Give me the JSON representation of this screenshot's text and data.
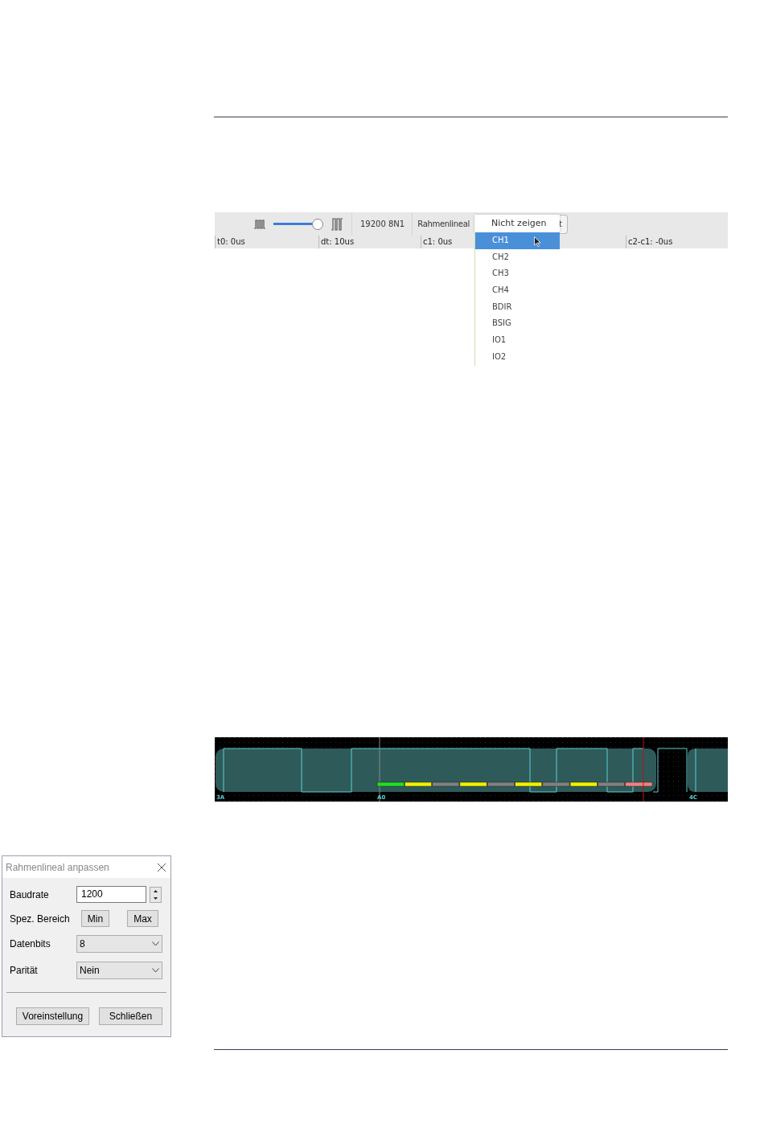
{
  "toolbar": {
    "rate_slider": {
      "level": 0.92
    },
    "serial_format": "19200 8N1",
    "ruler_label": "Rahmenlineal",
    "covered_button_text": "t"
  },
  "ruler_dropdown": {
    "value": "Nicht zeigen",
    "options": [
      {
        "label": "CH1",
        "selected": true
      },
      {
        "label": "CH2",
        "selected": false
      },
      {
        "label": "CH3",
        "selected": false
      },
      {
        "label": "CH4",
        "selected": false
      },
      {
        "label": "BDIR",
        "selected": false
      },
      {
        "label": "BSIG",
        "selected": false
      },
      {
        "label": "IO1",
        "selected": false
      },
      {
        "label": "IO2",
        "selected": false
      }
    ]
  },
  "status_cells": [
    "t0: 0us",
    "dt: 10us",
    "c1: 0us",
    "c2-c1: -0us"
  ],
  "waveform": {
    "byte_labels": [
      "3A",
      "A0",
      "4C"
    ],
    "bit_marks": [
      {
        "color": "#22dd22"
      },
      {
        "color": "#f0f000"
      },
      {
        "color": "#808080"
      },
      {
        "color": "#f0f000"
      },
      {
        "color": "#808080"
      },
      {
        "color": "#f0f000"
      },
      {
        "color": "#808080"
      },
      {
        "color": "#f0f000"
      },
      {
        "color": "#808080"
      },
      {
        "color": "#f08080"
      }
    ]
  },
  "dialog": {
    "title": "Rahmenlineal anpassen",
    "baudrate": {
      "label": "Baudrate",
      "value": "1200"
    },
    "range": {
      "label": "Spez. Bereich",
      "buttons": [
        "Min",
        "Max"
      ]
    },
    "data_bits": {
      "label": "Datenbits",
      "value": "8"
    },
    "parity": {
      "label": "Parität",
      "value": "Nein"
    },
    "buttons": [
      "Voreinstellung",
      "Schließen"
    ]
  }
}
